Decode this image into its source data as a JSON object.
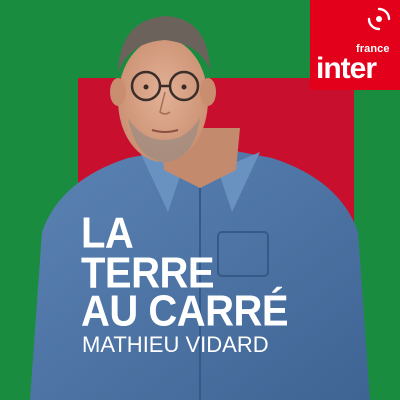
{
  "cover": {
    "title_lines": [
      "LA",
      "TERRE",
      "AU CARRÉ"
    ],
    "host": "MATHIEU VIDARD"
  },
  "brand": {
    "line1": "france",
    "line2": "inter",
    "icon": "radio-france-logo-icon",
    "color": "#e2001a"
  },
  "colors": {
    "background": "#1a8c3f",
    "square": "#c8102e",
    "shirt": "#4f77a8"
  }
}
